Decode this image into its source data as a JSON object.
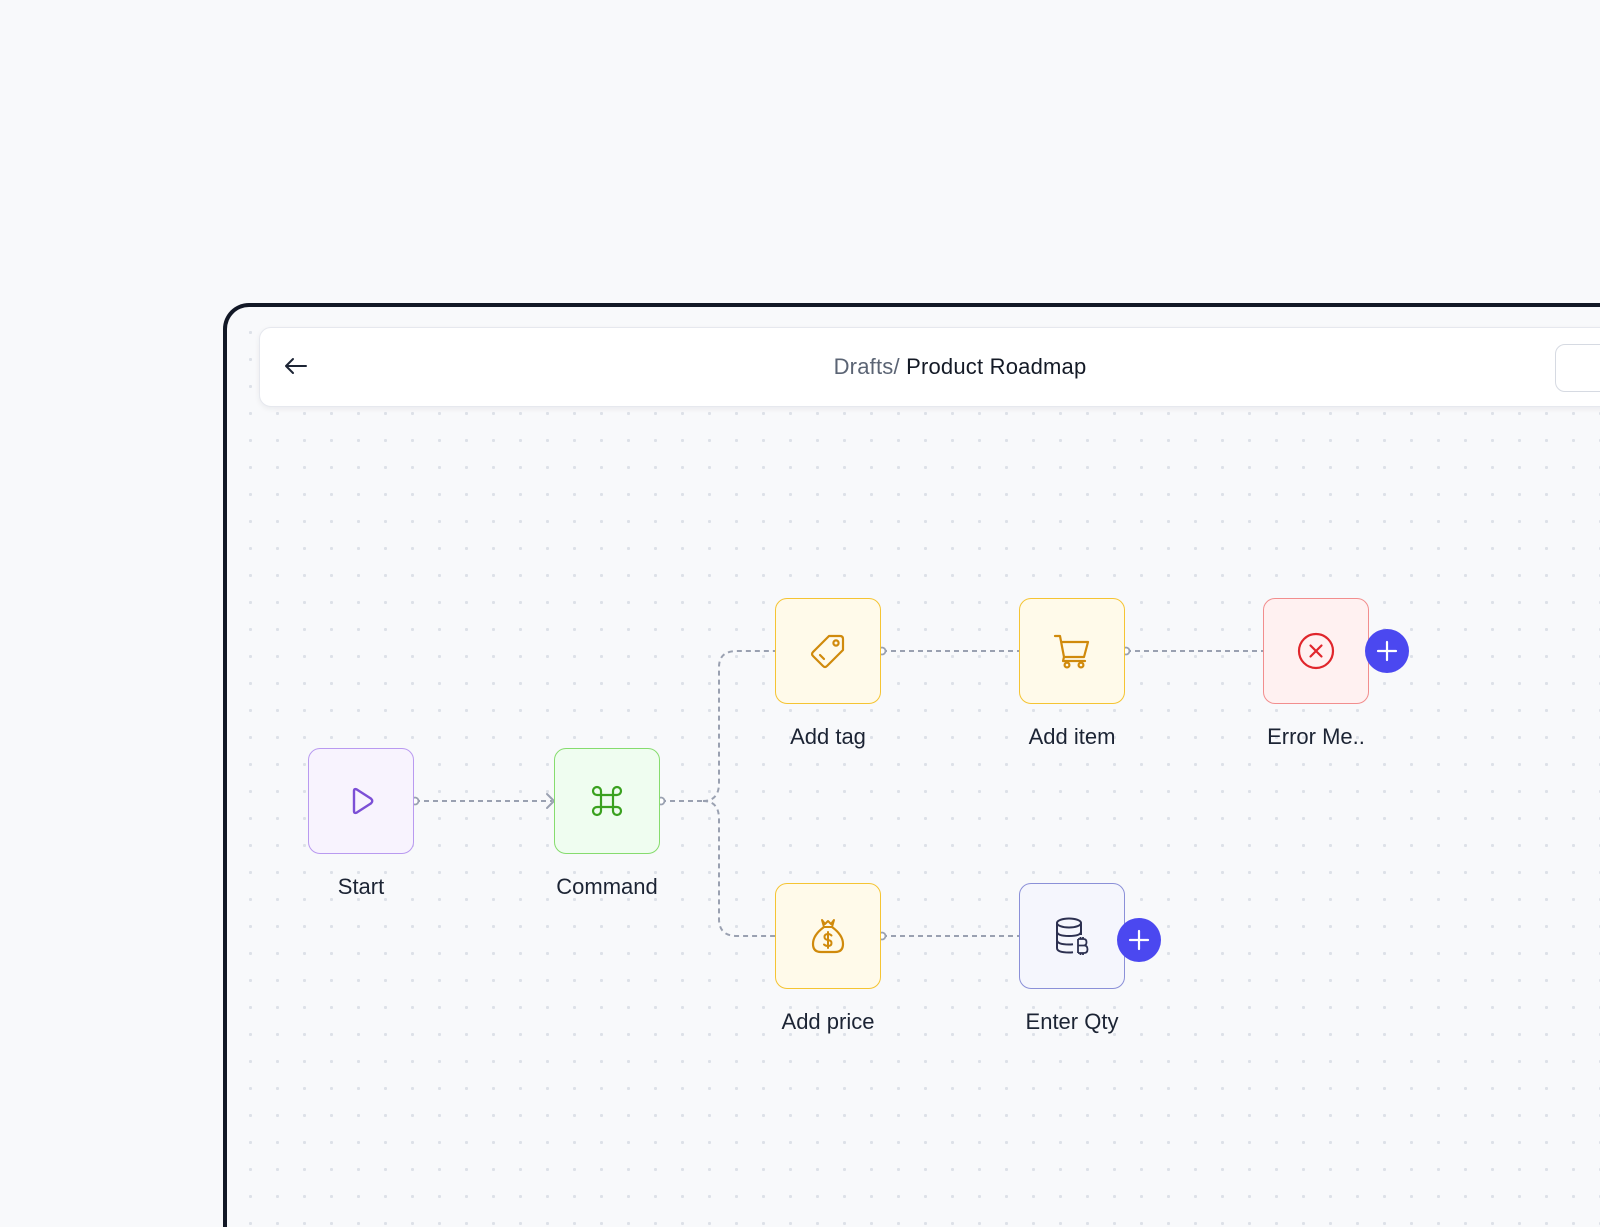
{
  "header": {
    "breadcrumb_parent": "Drafts/",
    "breadcrumb_current": "Product Roadmap"
  },
  "nodes": {
    "start": {
      "label": "Start",
      "icon": "play-icon",
      "color": "#7c4fd6"
    },
    "command": {
      "label": "Command",
      "icon": "command-icon",
      "color": "#3aa11f"
    },
    "add_tag": {
      "label": "Add tag",
      "icon": "tag-icon",
      "color": "#d08a0c"
    },
    "add_item": {
      "label": "Add item",
      "icon": "cart-icon",
      "color": "#d08a0c"
    },
    "error_message": {
      "label": "Error Me..",
      "icon": "x-circle-icon",
      "color": "#e0262c"
    },
    "add_price": {
      "label": "Add price",
      "icon": "money-bag-icon",
      "color": "#d08a0c"
    },
    "enter_qty": {
      "label": "Enter Qty",
      "icon": "database-bitcoin-icon",
      "color": "#2c3050"
    }
  },
  "accent": "#4b48f0"
}
